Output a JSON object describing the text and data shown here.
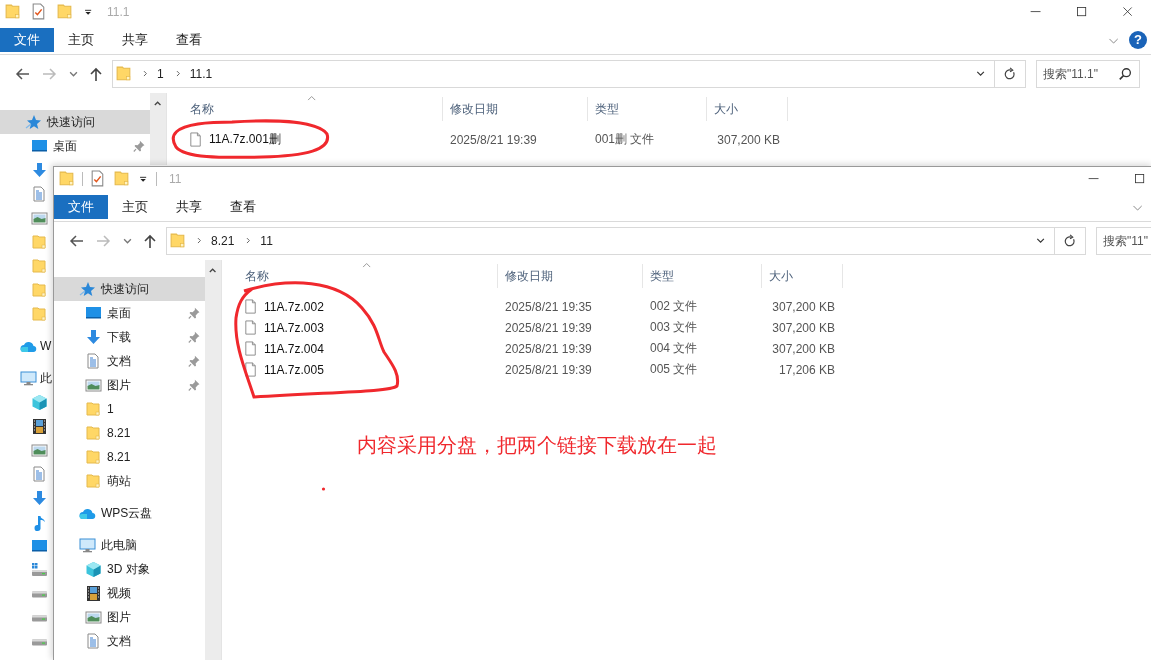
{
  "back_window": {
    "title": "11.1",
    "ribbon_tabs": [
      {
        "label": "文件",
        "selected": true
      },
      {
        "label": "主页",
        "selected": false
      },
      {
        "label": "共享",
        "selected": false
      },
      {
        "label": "查看",
        "selected": false
      }
    ],
    "help": "?",
    "address": {
      "path": [
        "1",
        "11.1"
      ]
    },
    "search": {
      "placeholder": "搜索\"11.1\""
    },
    "navigation": [
      {
        "label": "快速访问",
        "kind": "star",
        "selected": true,
        "children": [
          {
            "label": "桌面",
            "kind": "desktop",
            "selected": false,
            "pinned": true
          },
          {
            "kind": "download",
            "selected": false
          },
          {
            "kind": "doc",
            "selected": false
          },
          {
            "kind": "picture",
            "selected": false
          },
          {
            "kind": "folder",
            "selected": false
          },
          {
            "kind": "folder",
            "selected": false
          },
          {
            "kind": "folder",
            "selected": false
          },
          {
            "kind": "folder",
            "selected": false
          }
        ]
      },
      {
        "label": "W",
        "kind": "cloud",
        "selected": false
      },
      {
        "label": "此",
        "kind": "pc",
        "selected": false,
        "children": [
          {
            "kind": "cube",
            "selected": false
          },
          {
            "kind": "video",
            "selected": false
          },
          {
            "kind": "picture",
            "selected": false
          },
          {
            "kind": "doc",
            "selected": false
          },
          {
            "kind": "download",
            "selected": false
          },
          {
            "kind": "music",
            "selected": false
          },
          {
            "kind": "desktop",
            "selected": false
          },
          {
            "kind": "drivewin",
            "selected": false
          },
          {
            "kind": "drive",
            "selected": false
          },
          {
            "kind": "drive",
            "selected": false
          },
          {
            "kind": "drive",
            "selected": false
          }
        ]
      }
    ],
    "columns": [
      "名称",
      "修改日期",
      "类型",
      "大小"
    ],
    "files": [
      {
        "name": "11A.7z.001删",
        "modified": "2025/8/21 19:39",
        "type": "001删 文件",
        "size": "307,200 KB"
      }
    ]
  },
  "front_window": {
    "title": "11",
    "ribbon_tabs": [
      {
        "label": "文件",
        "selected": true
      },
      {
        "label": "主页",
        "selected": false
      },
      {
        "label": "共享",
        "selected": false
      },
      {
        "label": "查看",
        "selected": false
      }
    ],
    "address": {
      "path": [
        "8.21",
        "11"
      ]
    },
    "search": {
      "placeholder": "搜索\"11\""
    },
    "navigation": [
      {
        "label": "快速访问",
        "kind": "star",
        "selected": true,
        "children": [
          {
            "label": "桌面",
            "kind": "desktop",
            "selected": false,
            "pinned": true
          },
          {
            "label": "下载",
            "kind": "download",
            "selected": false,
            "pinned": true
          },
          {
            "label": "文档",
            "kind": "doc",
            "selected": false,
            "pinned": true
          },
          {
            "label": "图片",
            "kind": "picture",
            "selected": false,
            "pinned": true
          },
          {
            "label": "1",
            "kind": "folder",
            "selected": false,
            "pinned": false
          },
          {
            "label": "8.21",
            "kind": "folder",
            "selected": false,
            "pinned": false
          },
          {
            "label": "8.21",
            "kind": "folder",
            "selected": false,
            "pinned": false
          },
          {
            "label": "萌站",
            "kind": "folder",
            "selected": false,
            "pinned": false
          }
        ]
      },
      {
        "label": "WPS云盘",
        "kind": "cloud",
        "selected": false
      },
      {
        "label": "此电脑",
        "kind": "pc",
        "selected": false,
        "children": [
          {
            "label": "3D 对象",
            "kind": "cube",
            "selected": false,
            "pinned": false
          },
          {
            "label": "视频",
            "kind": "video",
            "selected": false,
            "pinned": false
          },
          {
            "label": "图片",
            "kind": "picture",
            "selected": false,
            "pinned": false
          },
          {
            "label": "文档",
            "kind": "doc",
            "selected": false,
            "pinned": false
          }
        ]
      }
    ],
    "columns": [
      "名称",
      "修改日期",
      "类型",
      "大小"
    ],
    "files": [
      {
        "name": "11A.7z.002",
        "modified": "2025/8/21 19:35",
        "type": "002 文件",
        "size": "307,200 KB"
      },
      {
        "name": "11A.7z.003",
        "modified": "2025/8/21 19:39",
        "type": "003 文件",
        "size": "307,200 KB"
      },
      {
        "name": "11A.7z.004",
        "modified": "2025/8/21 19:39",
        "type": "004 文件",
        "size": "307,200 KB"
      },
      {
        "name": "11A.7z.005",
        "modified": "2025/8/21 19:39",
        "type": "005 文件",
        "size": "17,206 KB"
      }
    ]
  },
  "annotation": {
    "note": "内容采用分盘，把两个链接下载放在一起"
  }
}
